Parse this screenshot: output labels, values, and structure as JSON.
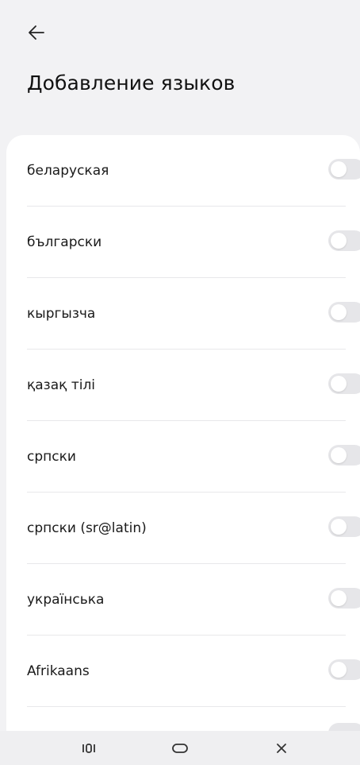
{
  "header": {
    "back_icon": "arrow-left-icon",
    "title": "Добавление языков"
  },
  "languages": [
    {
      "label": "беларуская",
      "enabled": false
    },
    {
      "label": "български",
      "enabled": false
    },
    {
      "label": "кыргызча",
      "enabled": false
    },
    {
      "label": "қазақ тілі",
      "enabled": false
    },
    {
      "label": "српски",
      "enabled": false
    },
    {
      "label": "српски (sr@latin)",
      "enabled": false
    },
    {
      "label": "українська",
      "enabled": false
    },
    {
      "label": "Afrikaans",
      "enabled": false
    }
  ],
  "navbar": {
    "recents_icon": "recents-icon",
    "home_icon": "home-icon",
    "close_icon": "close-icon"
  },
  "colors": {
    "background": "#f2f2f4",
    "card": "#ffffff",
    "toggle_off": "#e6e6e9"
  }
}
